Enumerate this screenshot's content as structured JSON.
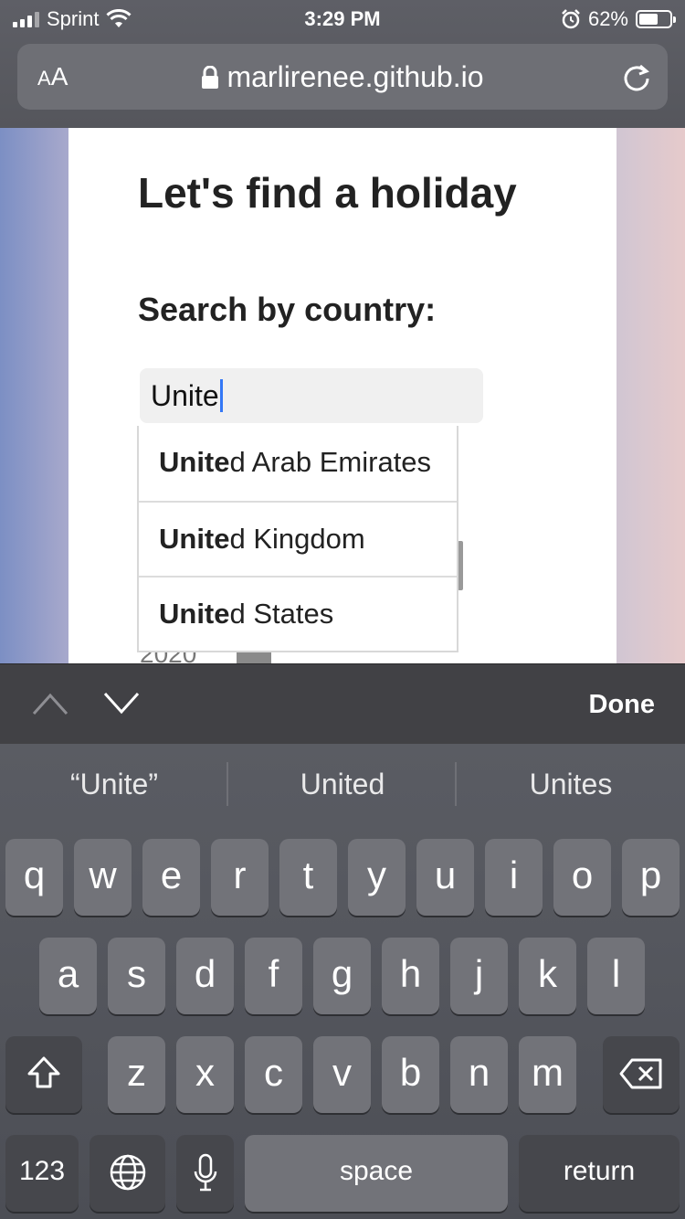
{
  "status_bar": {
    "carrier": "Sprint",
    "time": "3:29 PM",
    "battery": "62%"
  },
  "browser": {
    "text_size_button": "AA",
    "url": "marlirenee.github.io"
  },
  "page": {
    "title": "Let's find a holiday",
    "subtitle": "Search by country:",
    "search_value": "Unite",
    "partially_visible_year": "2020",
    "suggestions": [
      {
        "match": "Unite",
        "rest": "d Arab Emirates"
      },
      {
        "match": "Unite",
        "rest": "d Kingdom"
      },
      {
        "match": "Unite",
        "rest": "d States"
      }
    ]
  },
  "accessory_bar": {
    "done_label": "Done"
  },
  "keyboard": {
    "predictions": [
      "“Unite”",
      "United",
      "Unites"
    ],
    "row1": [
      "q",
      "w",
      "e",
      "r",
      "t",
      "y",
      "u",
      "i",
      "o",
      "p"
    ],
    "row2": [
      "a",
      "s",
      "d",
      "f",
      "g",
      "h",
      "j",
      "k",
      "l"
    ],
    "row3": [
      "z",
      "x",
      "c",
      "v",
      "b",
      "n",
      "m"
    ],
    "numbers_key": "123",
    "space_key": "space",
    "return_key": "return"
  }
}
